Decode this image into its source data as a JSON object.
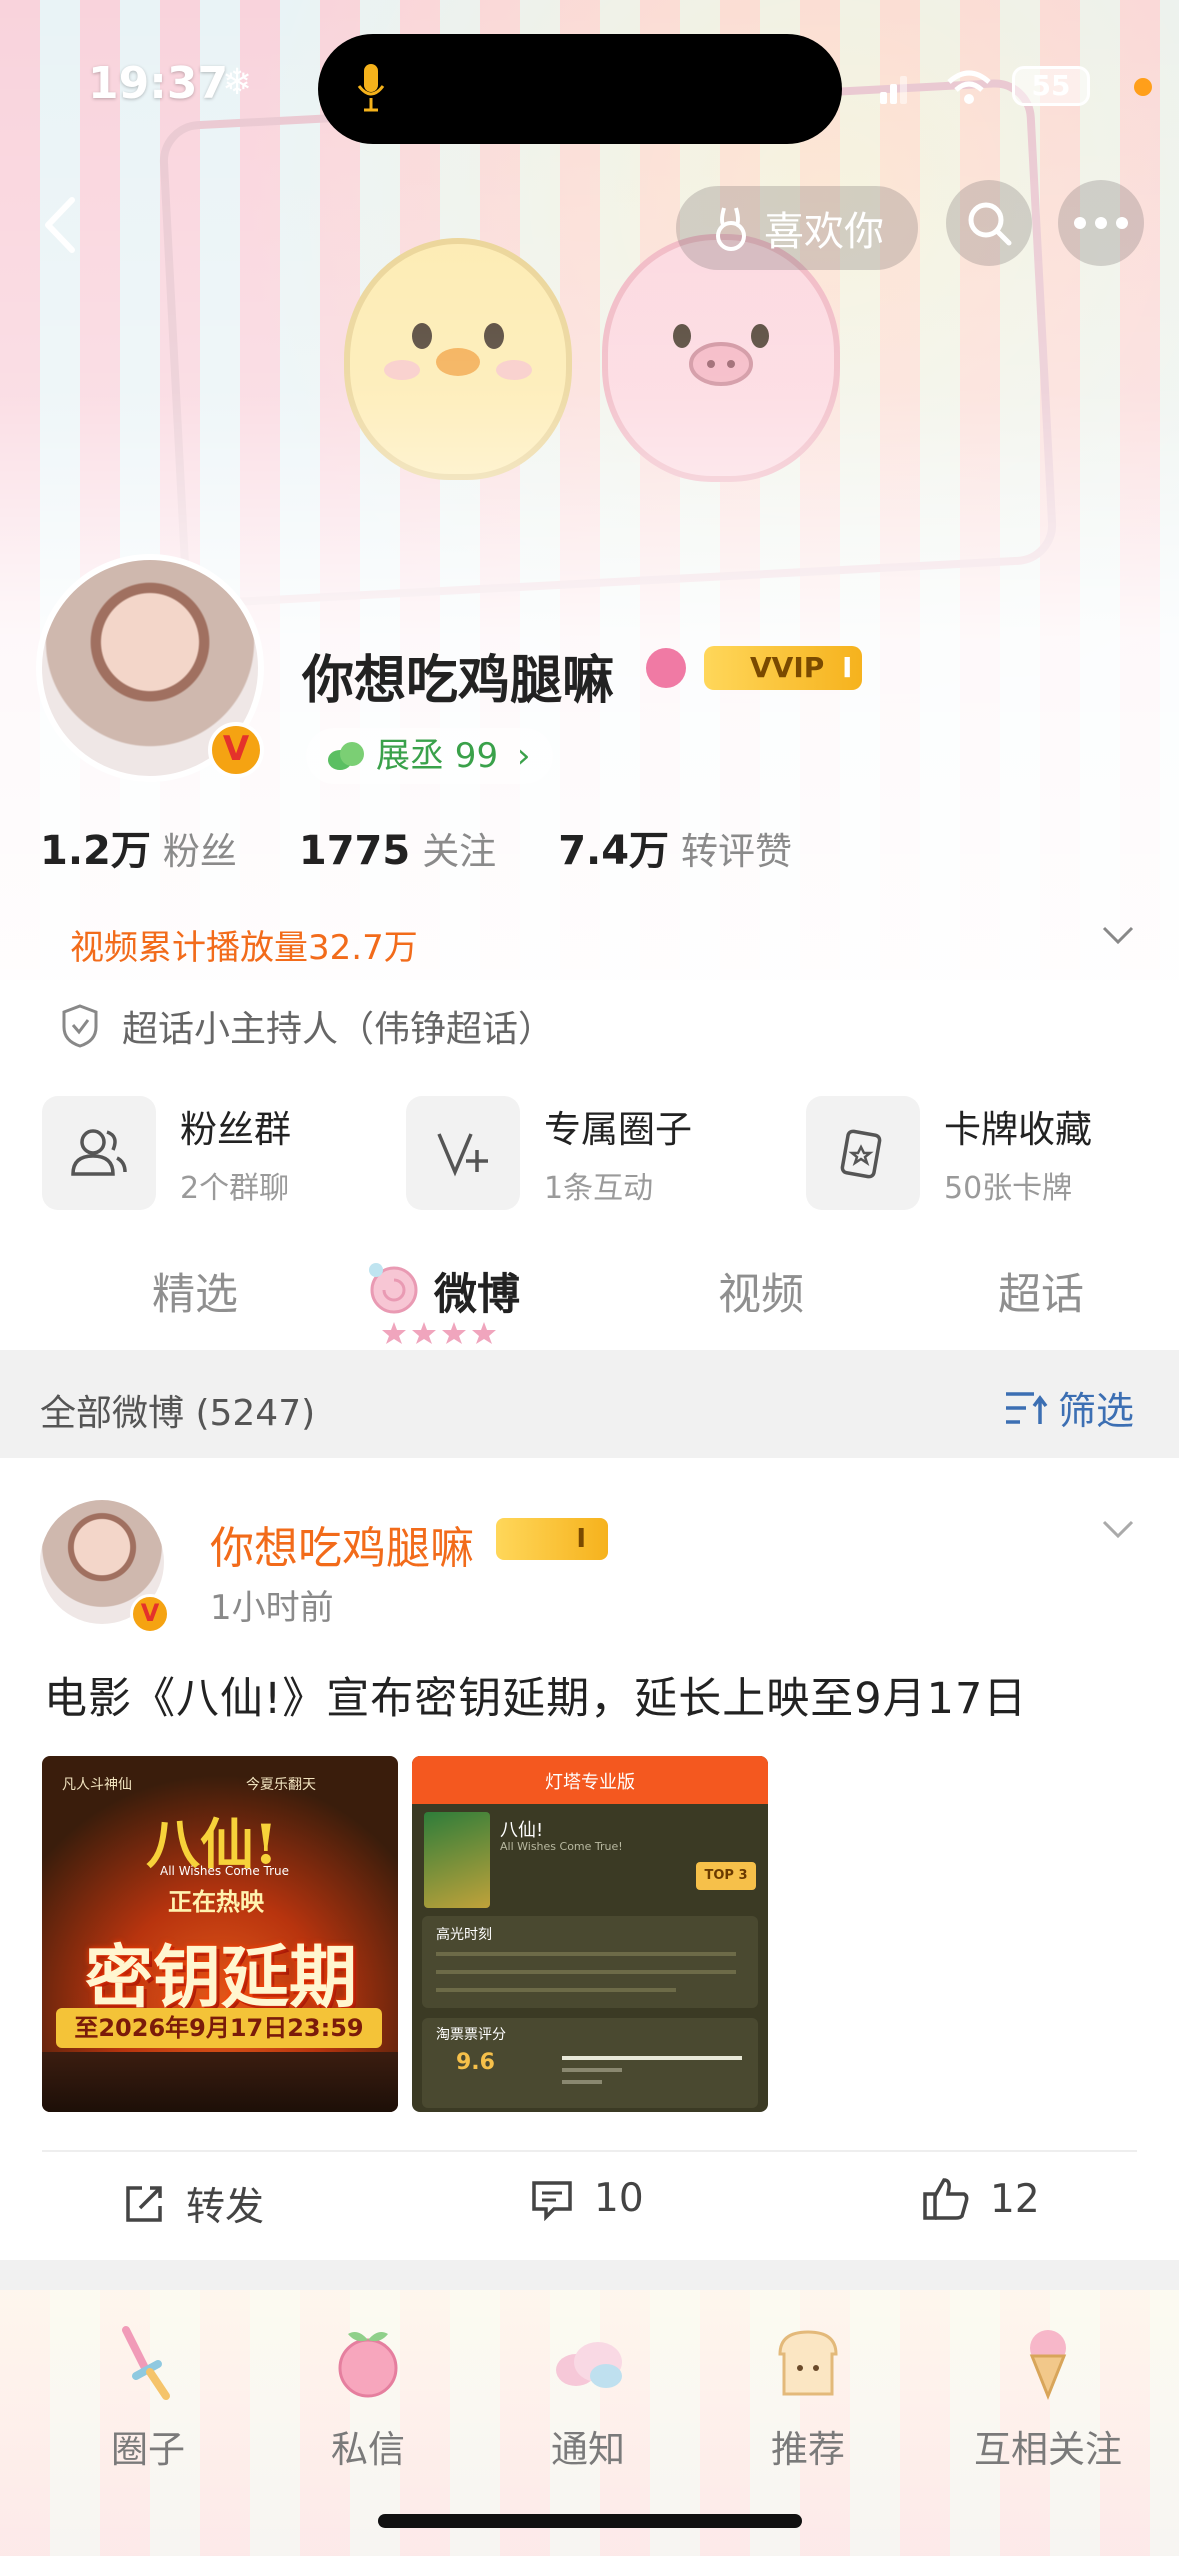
{
  "status_bar": {
    "time": "19:37",
    "battery": "55"
  },
  "header": {
    "like_label": "喜欢你"
  },
  "profile": {
    "name": "你想吃鸡腿嘛",
    "vip_label": "VVIP",
    "vip_level": "I",
    "growth_label": "展丞 99",
    "stats": [
      {
        "value": "1.2万",
        "label": "粉丝"
      },
      {
        "value": "1775",
        "label": "关注"
      },
      {
        "value": "7.4万",
        "label": "转评赞"
      }
    ],
    "video_plays": "视频累计播放量32.7万",
    "super_topic": "超话小主持人（伟铮超话）"
  },
  "features": [
    {
      "title": "粉丝群",
      "subtitle": "2个群聊",
      "icon": "people-icon"
    },
    {
      "title": "专属圈子",
      "subtitle": "1条互动",
      "icon": "circle-plus-icon"
    },
    {
      "title": "卡牌收藏",
      "subtitle": "50张卡牌",
      "icon": "card-icon"
    }
  ],
  "tabs": [
    {
      "label": "精选",
      "active": false
    },
    {
      "label": "微博",
      "active": true
    },
    {
      "label": "视频",
      "active": false
    },
    {
      "label": "超话",
      "active": false
    }
  ],
  "feed": {
    "title": "全部微博 (5247)",
    "filter_label": "筛选"
  },
  "post": {
    "author": "你想吃鸡腿嘛",
    "badge_level": "I",
    "time": "1小时前",
    "text": "电影《八仙!》宣布密钥延期，延长上映至9月17日",
    "image1": {
      "top_left": "凡人斗神仙",
      "top_right": "今夏乐翻天",
      "title": "八仙!",
      "subtitle": "All Wishes Come True",
      "now_showing": "正在热映",
      "headline": "密钥延期",
      "date_line": "至2026年9月17日23:59"
    },
    "image2": {
      "app": "灯塔专业版",
      "movie": "八仙!",
      "movie_en": "All Wishes Come True!",
      "rank": "TOP 3",
      "section": "高光时刻",
      "rating_label": "淘票票评分",
      "rating": "9.6"
    },
    "repost_label": "转发",
    "comments": "10",
    "likes": "12"
  },
  "bottom_nav": [
    {
      "label": "圈子",
      "icon": "sword-icon"
    },
    {
      "label": "私信",
      "icon": "peach-icon"
    },
    {
      "label": "通知",
      "icon": "cloud-icon"
    },
    {
      "label": "推荐",
      "icon": "toast-icon"
    },
    {
      "label": "互相关注",
      "icon": "icecream-icon"
    }
  ],
  "colors": {
    "accent": "#f26b1a",
    "link": "#3c6fb3",
    "gold": "#f6b21d"
  }
}
